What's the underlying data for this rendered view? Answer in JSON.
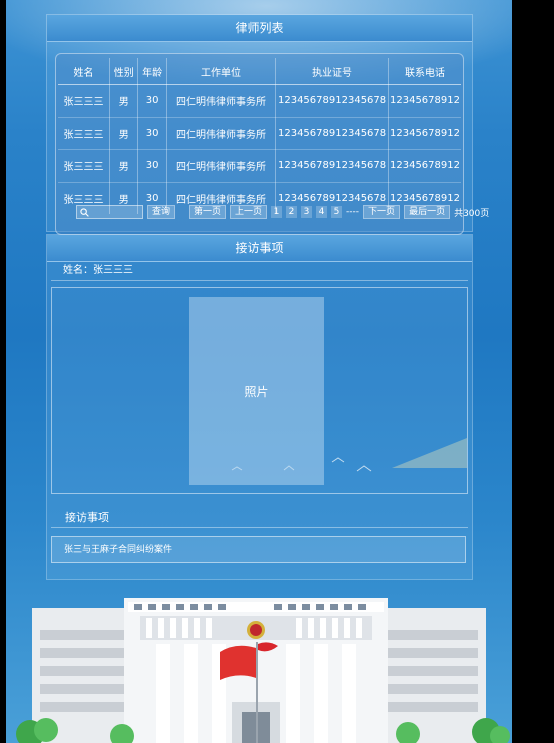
{
  "lawyer_list": {
    "title": "律师列表",
    "columns": [
      "姓名",
      "性别",
      "年龄",
      "工作单位",
      "执业证号",
      "联系电话"
    ],
    "rows": [
      [
        "张三三三",
        "男",
        "30",
        "四仁明伟律师事务所",
        "12345678912345678",
        "12345678912"
      ],
      [
        "张三三三",
        "男",
        "30",
        "四仁明伟律师事务所",
        "12345678912345678",
        "12345678912"
      ],
      [
        "张三三三",
        "男",
        "30",
        "四仁明伟律师事务所",
        "12345678912345678",
        "12345678912"
      ],
      [
        "张三三三",
        "男",
        "30",
        "四仁明伟律师事务所",
        "12345678912345678",
        "12345678912"
      ]
    ]
  },
  "pager": {
    "search_icon": "search-icon",
    "query_label": "查询",
    "first_label": "第一页",
    "prev_label": "上一页",
    "pages": [
      "1",
      "2",
      "3",
      "4",
      "5"
    ],
    "ellipsis": "----",
    "next_label": "下一页",
    "last_label": "最后一页",
    "total_label": "共300页"
  },
  "visit": {
    "title": "接访事项",
    "name_line": "姓名：张三三三",
    "photo_label": "照片",
    "matters_title": "接访事项",
    "case_text": "张三与王麻子合同纠纷案件"
  }
}
